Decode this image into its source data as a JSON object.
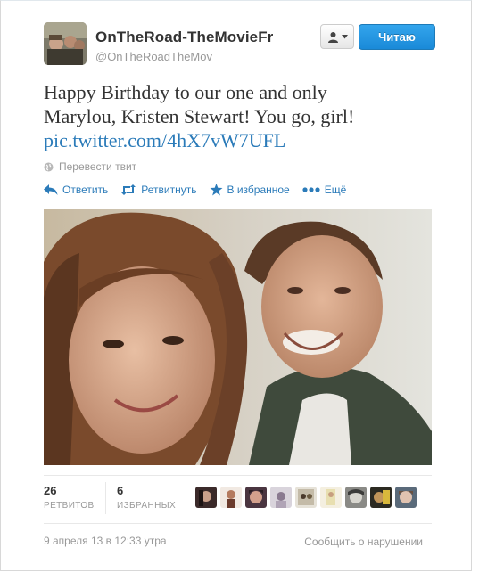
{
  "user": {
    "display_name": "OnTheRoad-TheMovieFr",
    "handle": "@OnTheRoadTheMov"
  },
  "buttons": {
    "follow_label": "Читаю",
    "user_menu_icon": "person-icon"
  },
  "tweet": {
    "text_line1": "Happy Birthday to our one and only",
    "text_line2": "Marylou, Kristen Stewart! You go, girl!",
    "link": "pic.twitter.com/4hX7vW7UFL",
    "translate_label": "Перевести твит"
  },
  "actions": {
    "reply": "Ответить",
    "retweet": "Ретвитнуть",
    "favorite": "В избранное",
    "more": "Ещё"
  },
  "stats": {
    "retweets_count": "26",
    "retweets_label": "РЕТВИТОВ",
    "favorites_count": "6",
    "favorites_label": "ИЗБРАННЫХ"
  },
  "footer": {
    "timestamp": "9 апреля 13 в 12:33 утра",
    "report": "Сообщить о нарушении"
  },
  "colors": {
    "link": "#2b7bb9",
    "follow_button": "#1a8ad8",
    "muted_text": "#999999"
  }
}
